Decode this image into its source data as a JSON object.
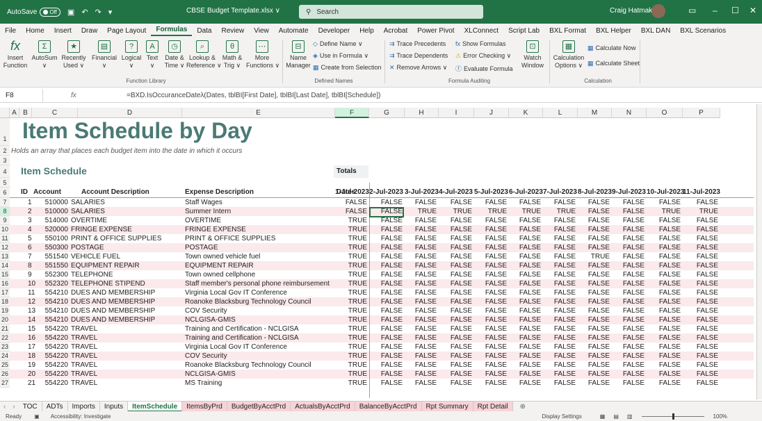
{
  "titlebar": {
    "autosave_label": "AutoSave",
    "toggle_label": "Off",
    "filename": "CBSE Budget Template.xlsx",
    "filename_chevron": "∨",
    "search_placeholder": "Search",
    "user_name": "Craig Hatmaker"
  },
  "menu": [
    "File",
    "Home",
    "Insert",
    "Draw",
    "Page Layout",
    "Formulas",
    "Data",
    "Review",
    "View",
    "Automate",
    "Developer",
    "Help",
    "Acrobat",
    "Power Pivot",
    "XLConnect",
    "Script Lab",
    "BXL Format",
    "BXL Helper",
    "BXL DAN",
    "BXL Scenarios"
  ],
  "menu_active": "Formulas",
  "ribbon": {
    "buttons": [
      "Insert\nFunction",
      "AutoSum\n∨",
      "Recently\nUsed ∨",
      "Financial\n∨",
      "Logical\n∨",
      "Text\n∨",
      "Date &\nTime ∨",
      "Lookup &\nReference ∨",
      "Math &\nTrig ∨",
      "More\nFunctions ∨",
      "Name\nManager",
      "Watch\nWindow",
      "Calculation\nOptions ∨"
    ],
    "defined_names": [
      "Define Name ∨",
      "Use in Formula ∨",
      "Create from Selection"
    ],
    "auditing": [
      "Trace Precedents",
      "Trace Dependents",
      "Remove Arrows ∨",
      "Show Formulas",
      "Error Checking ∨",
      "Evaluate Formula"
    ],
    "calc": [
      "Calculate Now",
      "Calculate Sheet"
    ],
    "groups": [
      "Function Library",
      "Defined Names",
      "Formula Auditing",
      "Calculation"
    ]
  },
  "formula_bar": {
    "name_box": "F8",
    "fx": "fx",
    "formula": "=BXD.IsOccuranceDateλ(Dates, tblBI[First Date], tblBI[Last Date], tblBI[Schedule])"
  },
  "columns": [
    "A",
    "B",
    "C",
    "D",
    "E",
    "F",
    "G",
    "H",
    "I",
    "J",
    "K",
    "L",
    "M",
    "N",
    "O",
    "P"
  ],
  "rows": [
    "1",
    "2",
    "3",
    "4",
    "5",
    "6",
    "7",
    "8",
    "9",
    "10",
    "11",
    "12",
    "13",
    "14",
    "15",
    "16",
    "17",
    "18",
    "19",
    "20",
    "21",
    "22",
    "23",
    "24",
    "25",
    "26",
    "27"
  ],
  "sheet": {
    "title": "Item Schedule by Day",
    "subtitle": "Holds an array that places each budget item into the date in which it occurs",
    "section": "Item Schedule",
    "totals": "Totals",
    "headers": {
      "id": "ID",
      "account": "Account",
      "acct_desc": "Account Description",
      "exp_desc": "Expense Description",
      "dates": "Dates"
    },
    "dates": [
      "1-Jul-2023",
      "2-Jul-2023",
      "3-Jul-2023",
      "4-Jul-2023",
      "5-Jul-2023",
      "6-Jul-2023",
      "7-Jul-2023",
      "8-Jul-2023",
      "9-Jul-2023",
      "10-Jul-2023",
      "11-Jul-2023"
    ],
    "items": [
      {
        "id": "1",
        "acct": "510000",
        "adesc": "SALARIES",
        "edesc": "Staff Wages",
        "v": [
          "FALSE",
          "FALSE",
          "FALSE",
          "FALSE",
          "FALSE",
          "FALSE",
          "FALSE",
          "FALSE",
          "FALSE",
          "FALSE",
          "FALSE"
        ]
      },
      {
        "id": "2",
        "acct": "510000",
        "adesc": "SALARIES",
        "edesc": "Summer Intern",
        "v": [
          "FALSE",
          "FALSE",
          "TRUE",
          "TRUE",
          "TRUE",
          "TRUE",
          "TRUE",
          "FALSE",
          "FALSE",
          "TRUE",
          "TRUE"
        ]
      },
      {
        "id": "3",
        "acct": "514000",
        "adesc": "OVERTIME",
        "edesc": "OVERTIME",
        "v": [
          "TRUE",
          "FALSE",
          "FALSE",
          "FALSE",
          "FALSE",
          "FALSE",
          "FALSE",
          "FALSE",
          "FALSE",
          "FALSE",
          "FALSE"
        ]
      },
      {
        "id": "4",
        "acct": "520000",
        "adesc": "FRINGE EXPENSE",
        "edesc": "FRINGE EXPENSE",
        "v": [
          "TRUE",
          "FALSE",
          "FALSE",
          "FALSE",
          "FALSE",
          "FALSE",
          "FALSE",
          "FALSE",
          "FALSE",
          "FALSE",
          "FALSE"
        ]
      },
      {
        "id": "5",
        "acct": "550100",
        "adesc": "PRINT & OFFICE SUPPLIES",
        "edesc": "PRINT & OFFICE SUPPLIES",
        "v": [
          "TRUE",
          "FALSE",
          "FALSE",
          "FALSE",
          "FALSE",
          "FALSE",
          "FALSE",
          "FALSE",
          "FALSE",
          "FALSE",
          "FALSE"
        ]
      },
      {
        "id": "6",
        "acct": "550300",
        "adesc": "POSTAGE",
        "edesc": "POSTAGE",
        "v": [
          "TRUE",
          "FALSE",
          "FALSE",
          "FALSE",
          "FALSE",
          "FALSE",
          "FALSE",
          "FALSE",
          "FALSE",
          "FALSE",
          "FALSE"
        ]
      },
      {
        "id": "7",
        "acct": "551540",
        "adesc": "VEHICLE FUEL",
        "edesc": "Town owned vehicle fuel",
        "v": [
          "TRUE",
          "FALSE",
          "FALSE",
          "FALSE",
          "FALSE",
          "FALSE",
          "FALSE",
          "TRUE",
          "FALSE",
          "FALSE",
          "FALSE"
        ]
      },
      {
        "id": "8",
        "acct": "551550",
        "adesc": "EQUIPMENT REPAIR",
        "edesc": "EQUIPMENT REPAIR",
        "v": [
          "TRUE",
          "FALSE",
          "FALSE",
          "FALSE",
          "FALSE",
          "FALSE",
          "FALSE",
          "FALSE",
          "FALSE",
          "FALSE",
          "FALSE"
        ]
      },
      {
        "id": "9",
        "acct": "552300",
        "adesc": "TELEPHONE",
        "edesc": "Town owned cellphone",
        "v": [
          "TRUE",
          "FALSE",
          "FALSE",
          "FALSE",
          "FALSE",
          "FALSE",
          "FALSE",
          "FALSE",
          "FALSE",
          "FALSE",
          "FALSE"
        ]
      },
      {
        "id": "10",
        "acct": "552320",
        "adesc": "TELEPHONE STIPEND",
        "edesc": "Staff member's personal phone reimbursement",
        "v": [
          "TRUE",
          "FALSE",
          "FALSE",
          "FALSE",
          "FALSE",
          "FALSE",
          "FALSE",
          "FALSE",
          "FALSE",
          "FALSE",
          "FALSE"
        ]
      },
      {
        "id": "11",
        "acct": "554210",
        "adesc": "DUES AND MEMBERSHIP",
        "edesc": "Virginia Local Gov IT Conference",
        "v": [
          "TRUE",
          "FALSE",
          "FALSE",
          "FALSE",
          "FALSE",
          "FALSE",
          "FALSE",
          "FALSE",
          "FALSE",
          "FALSE",
          "FALSE"
        ]
      },
      {
        "id": "12",
        "acct": "554210",
        "adesc": "DUES AND MEMBERSHIP",
        "edesc": "Roanoke Blacksburg Technology Council",
        "v": [
          "TRUE",
          "FALSE",
          "FALSE",
          "FALSE",
          "FALSE",
          "FALSE",
          "FALSE",
          "FALSE",
          "FALSE",
          "FALSE",
          "FALSE"
        ]
      },
      {
        "id": "13",
        "acct": "554210",
        "adesc": "DUES AND MEMBERSHIP",
        "edesc": "COV Security",
        "v": [
          "TRUE",
          "FALSE",
          "FALSE",
          "FALSE",
          "FALSE",
          "FALSE",
          "FALSE",
          "FALSE",
          "FALSE",
          "FALSE",
          "FALSE"
        ]
      },
      {
        "id": "14",
        "acct": "554210",
        "adesc": "DUES AND MEMBERSHIP",
        "edesc": "NCLGISA-GMIS",
        "v": [
          "TRUE",
          "FALSE",
          "FALSE",
          "FALSE",
          "FALSE",
          "FALSE",
          "FALSE",
          "FALSE",
          "FALSE",
          "FALSE",
          "FALSE"
        ]
      },
      {
        "id": "15",
        "acct": "554220",
        "adesc": "TRAVEL",
        "edesc": "Training and Certification - NCLGISA",
        "v": [
          "TRUE",
          "FALSE",
          "FALSE",
          "FALSE",
          "FALSE",
          "FALSE",
          "FALSE",
          "FALSE",
          "FALSE",
          "FALSE",
          "FALSE"
        ]
      },
      {
        "id": "16",
        "acct": "554220",
        "adesc": "TRAVEL",
        "edesc": "Training and Certification - NCLGISA",
        "v": [
          "TRUE",
          "FALSE",
          "FALSE",
          "FALSE",
          "FALSE",
          "FALSE",
          "FALSE",
          "FALSE",
          "FALSE",
          "FALSE",
          "FALSE"
        ]
      },
      {
        "id": "17",
        "acct": "554220",
        "adesc": "TRAVEL",
        "edesc": "Virginia Local Gov IT Conference",
        "v": [
          "TRUE",
          "FALSE",
          "FALSE",
          "FALSE",
          "FALSE",
          "FALSE",
          "FALSE",
          "FALSE",
          "FALSE",
          "FALSE",
          "FALSE"
        ]
      },
      {
        "id": "18",
        "acct": "554220",
        "adesc": "TRAVEL",
        "edesc": "COV Security",
        "v": [
          "TRUE",
          "FALSE",
          "FALSE",
          "FALSE",
          "FALSE",
          "FALSE",
          "FALSE",
          "FALSE",
          "FALSE",
          "FALSE",
          "FALSE"
        ]
      },
      {
        "id": "19",
        "acct": "554220",
        "adesc": "TRAVEL",
        "edesc": "Roanoke Blacksburg Technology Council",
        "v": [
          "TRUE",
          "FALSE",
          "FALSE",
          "FALSE",
          "FALSE",
          "FALSE",
          "FALSE",
          "FALSE",
          "FALSE",
          "FALSE",
          "FALSE"
        ]
      },
      {
        "id": "20",
        "acct": "554220",
        "adesc": "TRAVEL",
        "edesc": "NCLGISA-GMIS",
        "v": [
          "TRUE",
          "FALSE",
          "FALSE",
          "FALSE",
          "FALSE",
          "FALSE",
          "FALSE",
          "FALSE",
          "FALSE",
          "FALSE",
          "FALSE"
        ]
      },
      {
        "id": "21",
        "acct": "554220",
        "adesc": "TRAVEL",
        "edesc": "MS Training",
        "v": [
          "TRUE",
          "FALSE",
          "FALSE",
          "FALSE",
          "FALSE",
          "FALSE",
          "FALSE",
          "FALSE",
          "FALSE",
          "FALSE",
          "FALSE"
        ]
      }
    ]
  },
  "tabs": [
    "TOC",
    "ADTs",
    "Imports",
    "Inputs",
    "ItemSchedule",
    "ItemsByPrd",
    "BudgetByAcctPrd",
    "ActualsByAcctPrd",
    "BalanceByAcctPrd",
    "Rpt Summary",
    "Rpt Detail"
  ],
  "tab_active": "ItemSchedule",
  "status": {
    "ready": "Ready",
    "accessibility": "Accessibility: Investigate",
    "display": "Display Settings",
    "zoom": "100%"
  },
  "colors": {
    "excel_green": "#217346",
    "title_teal": "#4a7a75",
    "band_pink": "#fbe9ec"
  }
}
